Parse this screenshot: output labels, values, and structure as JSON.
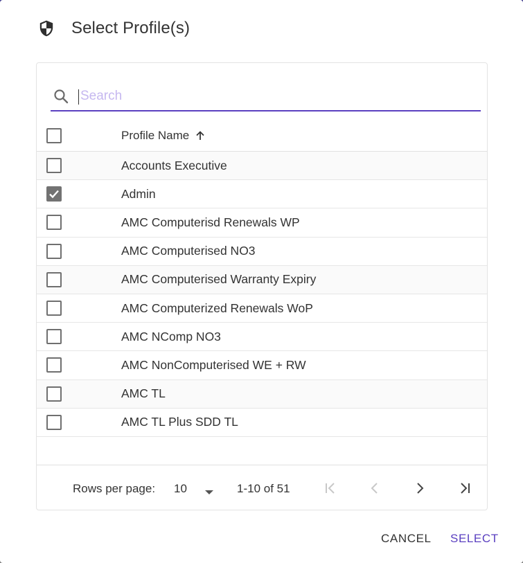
{
  "dialog": {
    "title": "Select Profile(s)",
    "title_icon": "shield-icon"
  },
  "search": {
    "placeholder": "Search",
    "value": ""
  },
  "table": {
    "column_header": "Profile Name",
    "sort_direction": "ascending",
    "rows": [
      {
        "name": "Accounts Executive",
        "checked": false
      },
      {
        "name": "Admin",
        "checked": true
      },
      {
        "name": "AMC Computerisd Renewals WP",
        "checked": false
      },
      {
        "name": "AMC Computerised NO3",
        "checked": false
      },
      {
        "name": "AMC Computerised Warranty Expiry",
        "checked": false
      },
      {
        "name": "AMC Computerized Renewals WoP",
        "checked": false
      },
      {
        "name": "AMC NComp NO3",
        "checked": false
      },
      {
        "name": "AMC NonComputerised WE + RW",
        "checked": false
      },
      {
        "name": "AMC TL",
        "checked": false
      },
      {
        "name": "AMC TL Plus SDD TL",
        "checked": false
      }
    ]
  },
  "pagination": {
    "rows_per_page_label": "Rows per page:",
    "rows_per_page_value": "10",
    "range_text": "1-10 of 51"
  },
  "actions": {
    "cancel_label": "CANCEL",
    "select_label": "SELECT"
  },
  "colors": {
    "accent": "#5a3fc0",
    "checkbox_checked": "#727272"
  }
}
